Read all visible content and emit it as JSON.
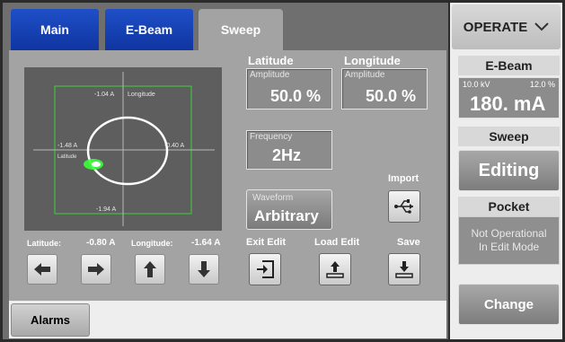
{
  "tabs": [
    {
      "label": "Main"
    },
    {
      "label": "E-Beam"
    },
    {
      "label": "Sweep"
    }
  ],
  "plot": {
    "top_label": "-1.04 A",
    "top_axis": "Longitude",
    "left_label": "-1.48 A",
    "left_axis": "Latitude",
    "right_label": "-0.40 A",
    "bottom_label": "-1.94 A"
  },
  "readouts": {
    "latitude_label": "Latitude:",
    "latitude_value": "-0.80 A",
    "longitude_label": "Longitude:",
    "longitude_value": "-1.64 A"
  },
  "latitude": {
    "header": "Latitude",
    "caption": "Amplitude",
    "value": "50.0 %"
  },
  "longitude": {
    "header": "Longitude",
    "caption": "Amplitude",
    "value": "50.0 %"
  },
  "frequency": {
    "caption": "Frequency",
    "value": "2Hz"
  },
  "waveform": {
    "caption": "Waveform",
    "value": "Arbitrary"
  },
  "buttons": {
    "import": "Import",
    "exit_edit": "Exit Edit",
    "load_edit": "Load Edit",
    "save": "Save",
    "alarms": "Alarms"
  },
  "right": {
    "operate": "OPERATE",
    "ebeam_header": "E-Beam",
    "kv": "10.0 kV",
    "percent": "12.0 %",
    "current": "180. mA",
    "sweep_header": "Sweep",
    "sweep_state": "Editing",
    "pocket_header": "Pocket",
    "pocket_line1": "Not Operational",
    "pocket_line2": "In Edit Mode",
    "change": "Change"
  },
  "colors": {
    "tab_blue": "#1f4fc8",
    "plot_green": "#3cd33c",
    "beam_spot": "#39ff39"
  }
}
